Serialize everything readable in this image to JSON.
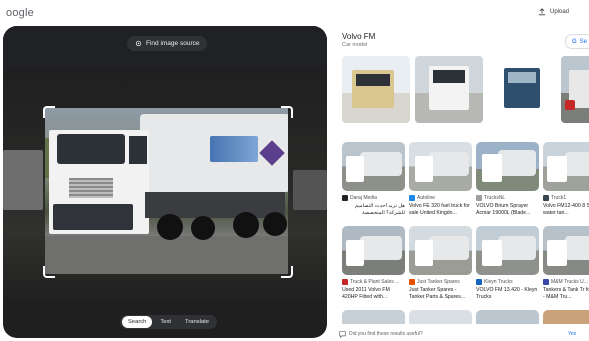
{
  "header": {
    "logo_text": "oogle",
    "upload_label": "Upload"
  },
  "lens": {
    "find_button_label": "Find image source",
    "modes": [
      "Search",
      "Text",
      "Translate"
    ],
    "active_mode": "Search"
  },
  "knowledge": {
    "title": "Volvo FM",
    "subtitle": "Car model",
    "search_chip_label": "Se"
  },
  "rows": [
    [
      {
        "source": "Daraj Media",
        "caption": "هل تريد أحدث التصاميم للشركة؟ المتخصصة بالاحتياجات العامة إلى"
      },
      {
        "source": "Autoline",
        "caption": "Volvo FE 320 fuel truck for sale United Kingdo..."
      },
      {
        "source": "TrucksNL",
        "caption": "VOLVO Brium Sprayer Acmar 19000L (Blade..."
      },
      {
        "source": "Truck1",
        "caption": "Volvo FM12-400 8 Stokota water tan..."
      }
    ],
    [
      {
        "source": "Truck & Plant Sales ...",
        "caption": "Used 2011 Volvo FM 420HP Fitted with..."
      },
      {
        "source": "Just Tanker Spares",
        "caption": "Just Tanker Spares - Tanker Parts & Spares..."
      },
      {
        "source": "Kleyn Trucks",
        "caption": "VOLVO FM 13.420 - Kleyn Trucks"
      },
      {
        "source": "M&M Trucks U...",
        "caption": "Tankers & Tank Tr for Sale - M&M Tru..."
      }
    ]
  ],
  "feedback": {
    "question": "Did you find these results useful?",
    "yes_label": "Yes"
  },
  "colors": {
    "lens_background": "#1f1f1f",
    "accent_blue": "#1a73e8",
    "favicon_colors": [
      "#222222",
      "#1e88e5",
      "#9e9e9e",
      "#37474f",
      "#c62828",
      "#e65100",
      "#1565c0",
      "#3949ab"
    ]
  },
  "icons": {
    "upload": "upload-icon",
    "find": "lens-icon",
    "feedback": "chat-icon"
  }
}
